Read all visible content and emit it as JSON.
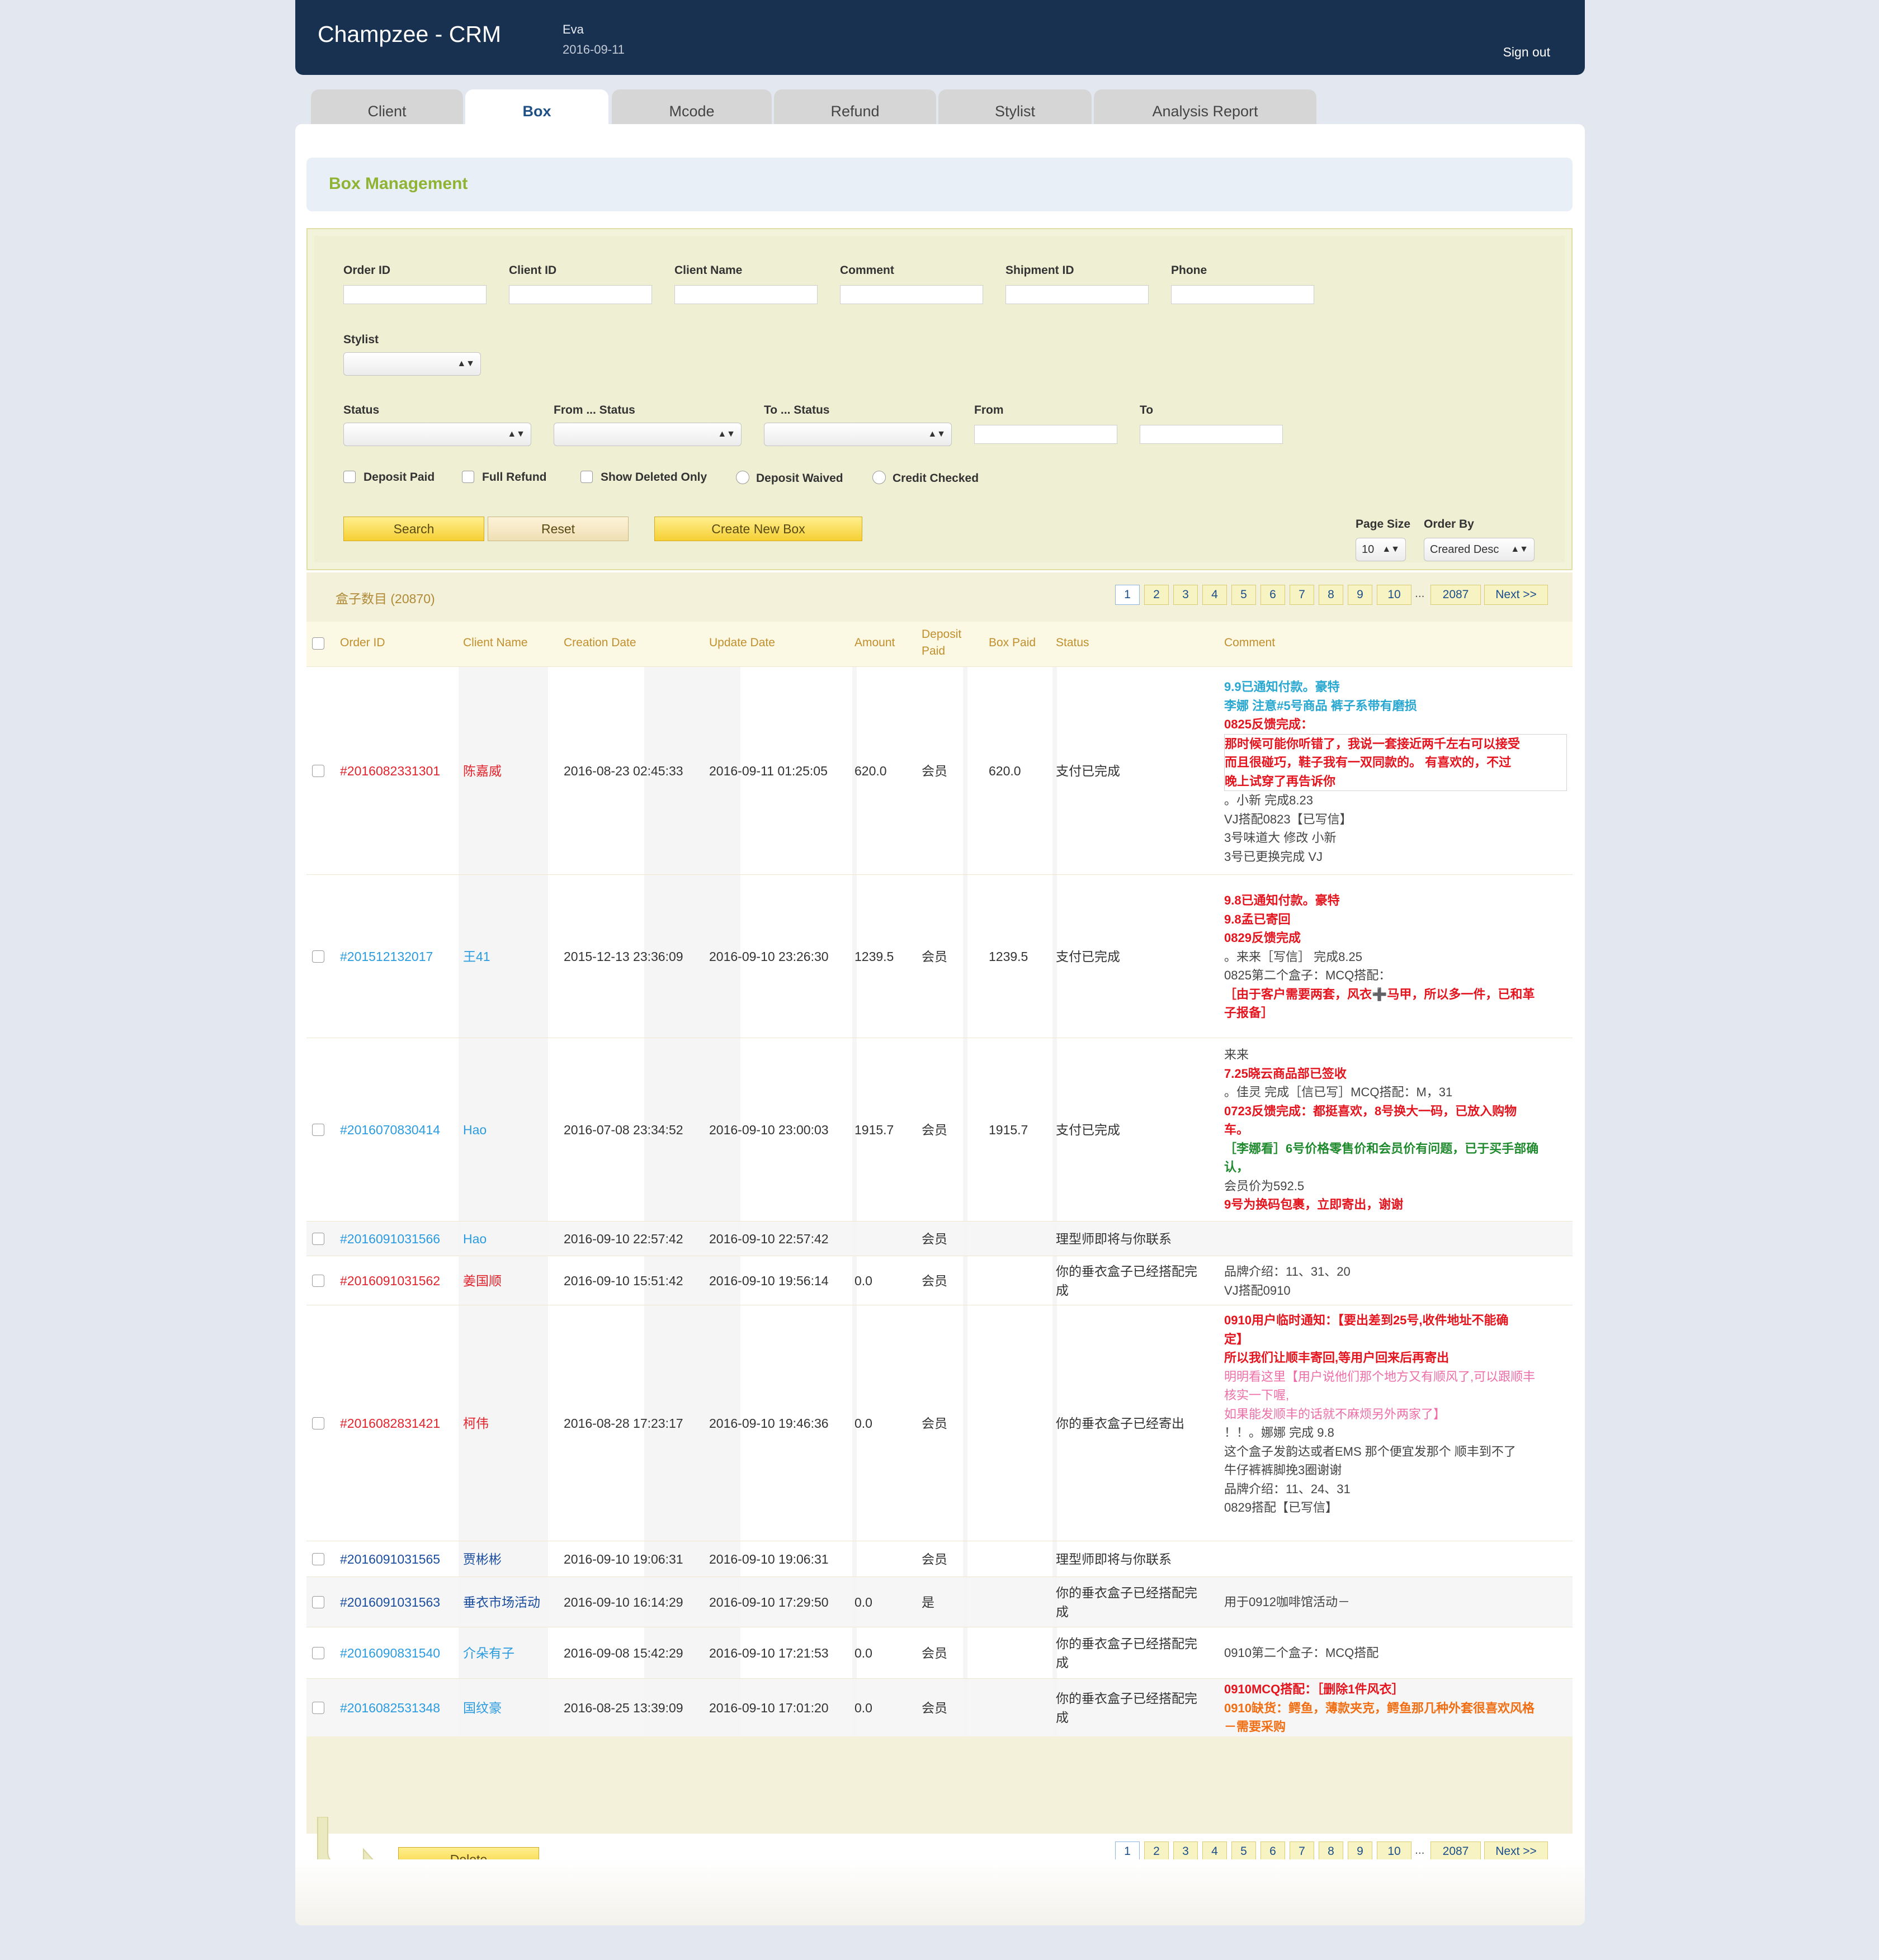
{
  "app": {
    "title": "Champzee - CRM",
    "user": "Eva",
    "date": "2016-09-11",
    "signout": "Sign out"
  },
  "tabs": [
    "Client",
    "Box",
    "Mcode",
    "Refund",
    "Stylist",
    "Analysis Report"
  ],
  "active_tab": "Box",
  "section_title": "Box Management",
  "filters": {
    "order_id": "Order ID",
    "client_id": "Client ID",
    "client_name": "Client Name",
    "comment": "Comment",
    "shipment_id": "Shipment ID",
    "phone": "Phone",
    "stylist": "Stylist",
    "status": "Status",
    "from_status": "From ... Status",
    "to_status": "To ... Status",
    "from": "From",
    "to": "To",
    "deposit_paid": "Deposit Paid",
    "full_refund": "Full Refund",
    "show_deleted": "Show Deleted Only",
    "deposit_waived": "Deposit Waived",
    "credit_checked": "Credit Checked",
    "search": "Search",
    "reset": "Reset",
    "create": "Create New Box",
    "page_size_label": "Page Size",
    "page_size": "10",
    "order_by_label": "Order By",
    "order_by": "Creared Desc"
  },
  "list": {
    "count": "盒子数目 (20870)",
    "pages": [
      "1",
      "2",
      "3",
      "4",
      "5",
      "6",
      "7",
      "8",
      "9",
      "10"
    ],
    "dots": "...",
    "last": "2087",
    "next": "Next >>",
    "headers": {
      "order_id": "Order ID",
      "client_name": "Client Name",
      "creation": "Creation Date",
      "update": "Update Date",
      "amount": "Amount",
      "deposit": "Deposit Paid",
      "box_paid": "Box Paid",
      "status": "Status",
      "comment": "Comment"
    },
    "delete": "Delete"
  },
  "rows": [
    {
      "id": "#2016082331301",
      "client": "陈嘉威",
      "created": "2016-08-23 02:45:33",
      "updated": "2016-09-11 01:25:05",
      "amount": "620.0",
      "deposit": "会员",
      "paid": "620.0",
      "status": "支付已完成",
      "comment": [
        "9.9已通知付款。豪特",
        "李娜 注意#5号商品 裤子系带有磨损",
        "0825反馈完成：",
        "那时候可能你听错了，我说一套接近两千左右可以接受",
        "而且很碰巧，鞋子我有一双同款的。  有喜欢的，不过",
        "  晚上试穿了再告诉你",
        "。小新 完成8.23",
        "VJ搭配0823【已写信】",
        "3号味道大 修改 小新",
        "3号已更换完成 VJ"
      ]
    },
    {
      "id": "#201512132017",
      "client": "王41",
      "created": "2015-12-13 23:36:09",
      "updated": "2016-09-10 23:26:30",
      "amount": "1239.5",
      "deposit": "会员",
      "paid": "1239.5",
      "status": "支付已完成",
      "comment": [
        "9.8已通知付款。豪特",
        "9.8孟已寄回",
        " 0829反馈完成",
        "。来来［写信］  完成8.25",
        "0825第二个盒子：MCQ搭配：",
        "［由于客户需要两套，风衣➕马甲，所以多一件，已和革",
        "子报备］"
      ]
    },
    {
      "id": "#2016070830414",
      "client": "Hao",
      "created": "2016-07-08 23:34:52",
      "updated": "2016-09-10 23:00:03",
      "amount": "1915.7",
      "deposit": "会员",
      "paid": "1915.7",
      "status": "支付已完成",
      "comment": [
        "来来",
        "7.25晓云商品部已签收",
        "。佳灵 完成［信已写］MCQ搭配：M，31",
        "0723反馈完成：都挺喜欢，8号换大一码，已放入购物",
        "车。",
        "［李娜看］6号价格零售价和会员价有问题，已于买手部确",
        "认，",
        "会员价为592.5",
        "9号为换码包裹，立即寄出，谢谢"
      ]
    },
    {
      "id": "#2016091031566",
      "client": "Hao",
      "created": "2016-09-10 22:57:42",
      "updated": "2016-09-10 22:57:42",
      "amount": "",
      "deposit": "会员",
      "paid": "",
      "status": "理型师即将与你联系",
      "comment": []
    },
    {
      "id": "#2016091031562",
      "client": "姜国顺",
      "created": "2016-09-10 15:51:42",
      "updated": "2016-09-10 19:56:14",
      "amount": "0.0",
      "deposit": "会员",
      "paid": "",
      "status": "你的垂衣盒子已经搭配完成",
      "comment": [
        "品牌介绍：11、31、20",
        "VJ搭配0910"
      ]
    },
    {
      "id": "#2016082831421",
      "client": "柯伟",
      "created": "2016-08-28 17:23:17",
      "updated": "2016-09-10 19:46:36",
      "amount": "0.0",
      "deposit": "会员",
      "paid": "",
      "status": "你的垂衣盒子已经寄出",
      "comment": [
        "0910用户临时通知：【要出差到25号,收件地址不能确",
        "定】",
        "所以我们让顺丰寄回,等用户回来后再寄出",
        "明明看这里【用户说他们那个地方又有顺风了,可以跟顺丰",
        "核实一下喔,",
        "如果能发顺丰的话就不麻烦另外两家了】",
        "",
        "！！。娜娜 完成 9.8",
        "这个盒子发韵达或者EMS 那个便宜发那个 顺丰到不了",
        "牛仔裤裤脚挽3圈谢谢",
        "品牌介绍：11、24、31",
        "0829搭配【已写信】"
      ]
    },
    {
      "id": "#2016091031565",
      "client": "贾彬彬",
      "created": "2016-09-10 19:06:31",
      "updated": "2016-09-10 19:06:31",
      "amount": "",
      "deposit": "会员",
      "paid": "",
      "status": "理型师即将与你联系",
      "comment": []
    },
    {
      "id": "#2016091031563",
      "client": "垂衣市场活动",
      "created": "2016-09-10 16:14:29",
      "updated": "2016-09-10 17:29:50",
      "amount": "0.0",
      "deposit": "是",
      "paid": "",
      "status": "你的垂衣盒子已经搭配完成",
      "comment": [
        "用于0912咖啡馆活动－"
      ]
    },
    {
      "id": "#2016090831540",
      "client": "介朵有子",
      "created": "2016-09-08 15:42:29",
      "updated": "2016-09-10 17:21:53",
      "amount": "0.0",
      "deposit": "会员",
      "paid": "",
      "status": "你的垂衣盒子已经搭配完成",
      "comment": [
        "0910第二个盒子：MCQ搭配"
      ]
    },
    {
      "id": "#2016082531348",
      "client": "国纹豪",
      "created": "2016-08-25 13:39:09",
      "updated": "2016-09-10 17:01:20",
      "amount": "0.0",
      "deposit": "会员",
      "paid": "",
      "status": "你的垂衣盒子已经搭配完成",
      "comment": [
        "0910MCQ搭配：［删除1件风衣］",
        "0910缺货：鳄鱼，薄款夹克，鳄鱼那几种外套很喜欢风格",
        "－需要采购"
      ]
    }
  ],
  "colors": {
    "header": "#193150",
    "accent_green": "#8fb333",
    "button_yellow": "#f5cf33",
    "link_red": "#e0242d",
    "link_blue": "#2b9be0",
    "link_navy": "#1a4d9e"
  }
}
